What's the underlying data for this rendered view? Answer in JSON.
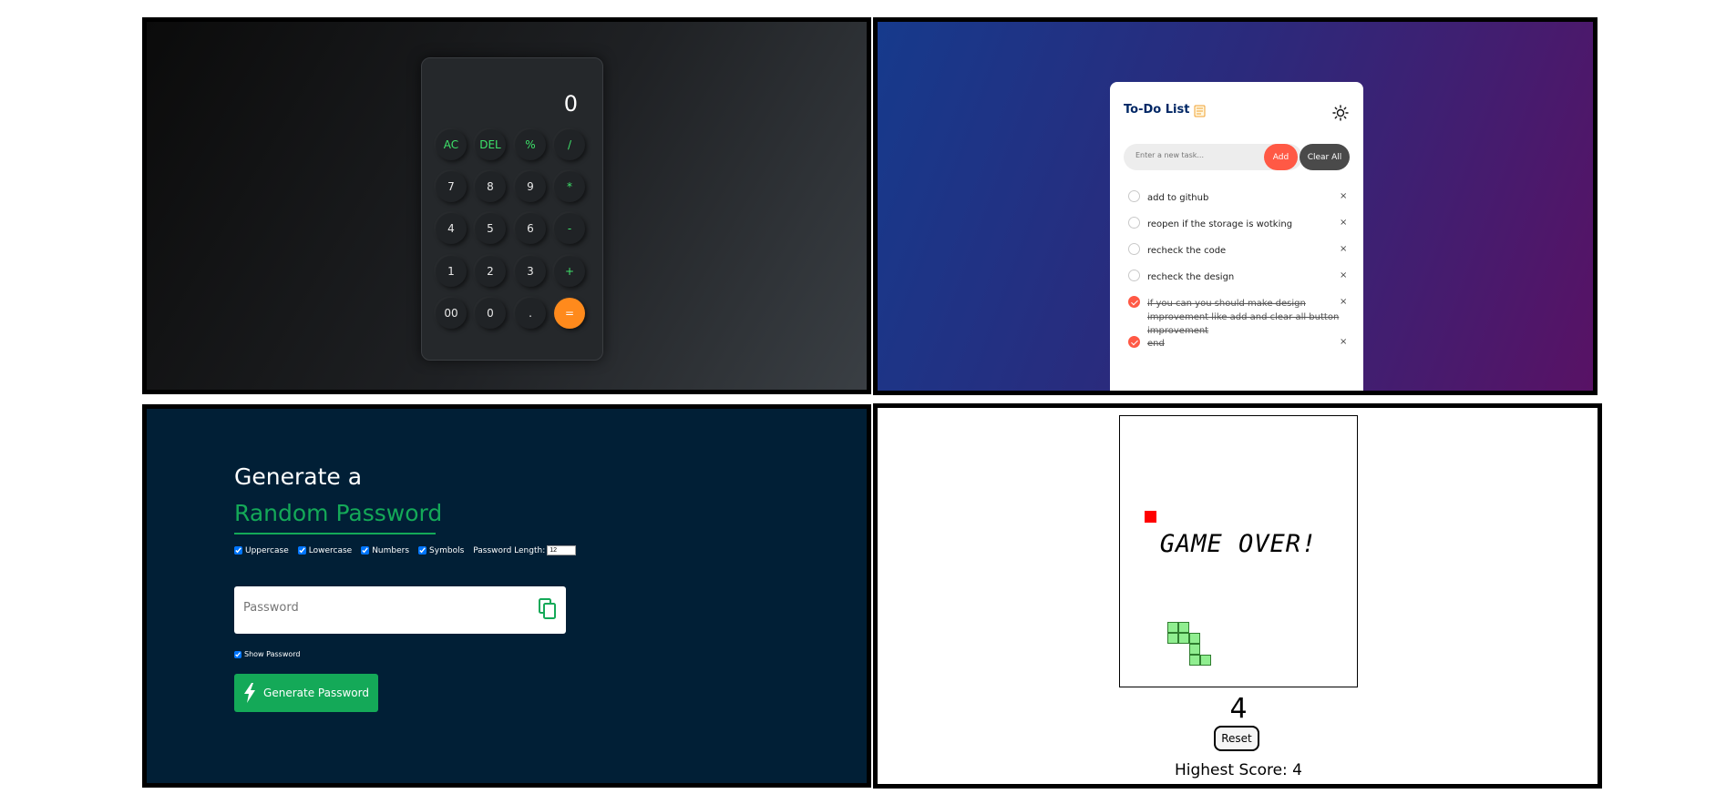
{
  "calculator": {
    "display": "0",
    "keys": [
      [
        "AC",
        "DEL",
        "%",
        "/"
      ],
      [
        "7",
        "8",
        "9",
        "*"
      ],
      [
        "4",
        "5",
        "6",
        "-"
      ],
      [
        "1",
        "2",
        "3",
        "+"
      ],
      [
        "00",
        "0",
        ".",
        "="
      ]
    ],
    "accent_color": "#3ee36a",
    "equals_color": "#ff8a1c"
  },
  "todo": {
    "title": "To-Do List",
    "input_placeholder": "Enter a new task...",
    "add_label": "Add",
    "clear_label": "Clear All",
    "accent_color": "#ff5945",
    "items": [
      {
        "text": "add to github",
        "done": false
      },
      {
        "text": "reopen if the storage is wotking",
        "done": false
      },
      {
        "text": "recheck the code",
        "done": false
      },
      {
        "text": "recheck the design",
        "done": false
      },
      {
        "text": "if you can you should make design improvement like add and clear all button improvement",
        "done": true
      },
      {
        "text": "end",
        "done": true
      }
    ],
    "delete_glyph": "×"
  },
  "password": {
    "title_line1": "Generate a",
    "title_line2": "Random Password",
    "options": {
      "uppercase": "Uppercase",
      "lowercase": "Lowercase",
      "numbers": "Numbers",
      "symbols": "Symbols",
      "length_label": "Password Length:",
      "length_value": "12"
    },
    "input_placeholder": "Password",
    "show_label": "Show Password",
    "generate_label": "Generate Password",
    "accent_color": "#14a958"
  },
  "snake": {
    "message": "GAME OVER!",
    "score": "4",
    "reset_label": "Reset",
    "highest_label": "Highest Score: 4"
  }
}
